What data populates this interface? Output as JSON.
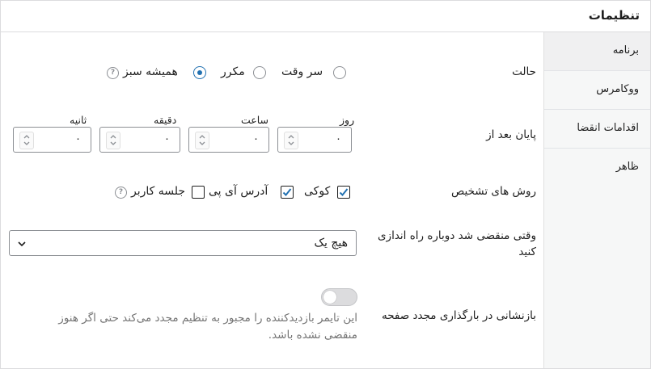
{
  "header": {
    "title": "تنظیمات"
  },
  "sidebar": {
    "items": [
      {
        "label": "برنامه"
      },
      {
        "label": "ووکامرس"
      },
      {
        "label": "اقدامات انقضا"
      },
      {
        "label": "ظاهر"
      }
    ]
  },
  "mode": {
    "label": "حالت",
    "options": [
      {
        "label": "سر وقت",
        "checked": false
      },
      {
        "label": "مکرر",
        "checked": false
      },
      {
        "label": "همیشه سبز",
        "checked": true
      }
    ]
  },
  "end_after": {
    "label": "پایان بعد از",
    "fields": [
      {
        "label": "روز",
        "value": "۰"
      },
      {
        "label": "ساعت",
        "value": "۰"
      },
      {
        "label": "دقیقه",
        "value": "۰"
      },
      {
        "label": "ثانیه",
        "value": "۰"
      }
    ]
  },
  "detection": {
    "label": "روش های تشخیص",
    "options": [
      {
        "label": "کوکی",
        "checked": true
      },
      {
        "label": "آدرس آی پی",
        "checked": true
      },
      {
        "label": "جلسه کاربر",
        "checked": false
      }
    ]
  },
  "restart": {
    "label_line1": "وقتی منقضی شد دوباره راه اندازی",
    "label_line2": "کنید",
    "value": "هیچ یک"
  },
  "reload_reset": {
    "label": "بازنشانی در بارگذاری مجدد صفحه",
    "enabled": false,
    "description_line1": "این تایمر بازدیدکننده را مجبور به تنظیم مجدد می‌کند حتی اگر هنوز",
    "description_line2": "منقضی نشده باشد."
  },
  "colors": {
    "accent": "#2271b1",
    "border": "#8c8f94",
    "muted": "#757575"
  }
}
